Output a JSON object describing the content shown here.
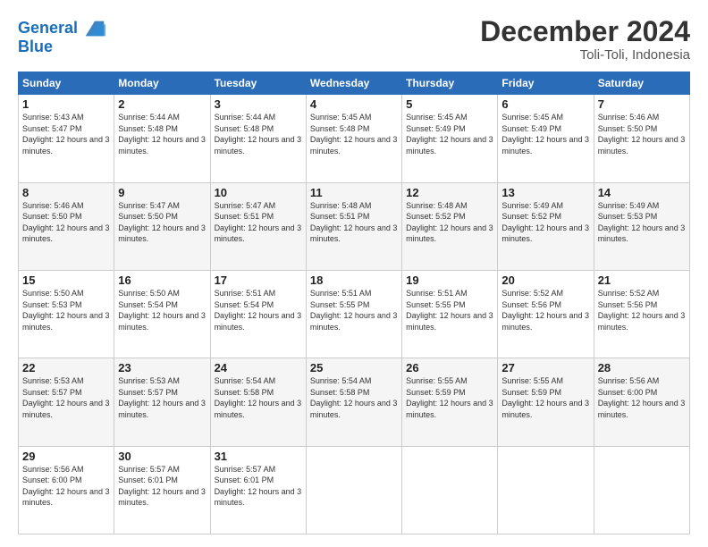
{
  "header": {
    "logo_line1": "General",
    "logo_line2": "Blue",
    "month_title": "December 2024",
    "location": "Toli-Toli, Indonesia"
  },
  "days_of_week": [
    "Sunday",
    "Monday",
    "Tuesday",
    "Wednesday",
    "Thursday",
    "Friday",
    "Saturday"
  ],
  "weeks": [
    [
      {
        "day": "1",
        "sunrise": "5:43 AM",
        "sunset": "5:47 PM",
        "daylight": "12 hours and 3 minutes."
      },
      {
        "day": "2",
        "sunrise": "5:44 AM",
        "sunset": "5:48 PM",
        "daylight": "12 hours and 3 minutes."
      },
      {
        "day": "3",
        "sunrise": "5:44 AM",
        "sunset": "5:48 PM",
        "daylight": "12 hours and 3 minutes."
      },
      {
        "day": "4",
        "sunrise": "5:45 AM",
        "sunset": "5:48 PM",
        "daylight": "12 hours and 3 minutes."
      },
      {
        "day": "5",
        "sunrise": "5:45 AM",
        "sunset": "5:49 PM",
        "daylight": "12 hours and 3 minutes."
      },
      {
        "day": "6",
        "sunrise": "5:45 AM",
        "sunset": "5:49 PM",
        "daylight": "12 hours and 3 minutes."
      },
      {
        "day": "7",
        "sunrise": "5:46 AM",
        "sunset": "5:50 PM",
        "daylight": "12 hours and 3 minutes."
      }
    ],
    [
      {
        "day": "8",
        "sunrise": "5:46 AM",
        "sunset": "5:50 PM",
        "daylight": "12 hours and 3 minutes."
      },
      {
        "day": "9",
        "sunrise": "5:47 AM",
        "sunset": "5:50 PM",
        "daylight": "12 hours and 3 minutes."
      },
      {
        "day": "10",
        "sunrise": "5:47 AM",
        "sunset": "5:51 PM",
        "daylight": "12 hours and 3 minutes."
      },
      {
        "day": "11",
        "sunrise": "5:48 AM",
        "sunset": "5:51 PM",
        "daylight": "12 hours and 3 minutes."
      },
      {
        "day": "12",
        "sunrise": "5:48 AM",
        "sunset": "5:52 PM",
        "daylight": "12 hours and 3 minutes."
      },
      {
        "day": "13",
        "sunrise": "5:49 AM",
        "sunset": "5:52 PM",
        "daylight": "12 hours and 3 minutes."
      },
      {
        "day": "14",
        "sunrise": "5:49 AM",
        "sunset": "5:53 PM",
        "daylight": "12 hours and 3 minutes."
      }
    ],
    [
      {
        "day": "15",
        "sunrise": "5:50 AM",
        "sunset": "5:53 PM",
        "daylight": "12 hours and 3 minutes."
      },
      {
        "day": "16",
        "sunrise": "5:50 AM",
        "sunset": "5:54 PM",
        "daylight": "12 hours and 3 minutes."
      },
      {
        "day": "17",
        "sunrise": "5:51 AM",
        "sunset": "5:54 PM",
        "daylight": "12 hours and 3 minutes."
      },
      {
        "day": "18",
        "sunrise": "5:51 AM",
        "sunset": "5:55 PM",
        "daylight": "12 hours and 3 minutes."
      },
      {
        "day": "19",
        "sunrise": "5:51 AM",
        "sunset": "5:55 PM",
        "daylight": "12 hours and 3 minutes."
      },
      {
        "day": "20",
        "sunrise": "5:52 AM",
        "sunset": "5:56 PM",
        "daylight": "12 hours and 3 minutes."
      },
      {
        "day": "21",
        "sunrise": "5:52 AM",
        "sunset": "5:56 PM",
        "daylight": "12 hours and 3 minutes."
      }
    ],
    [
      {
        "day": "22",
        "sunrise": "5:53 AM",
        "sunset": "5:57 PM",
        "daylight": "12 hours and 3 minutes."
      },
      {
        "day": "23",
        "sunrise": "5:53 AM",
        "sunset": "5:57 PM",
        "daylight": "12 hours and 3 minutes."
      },
      {
        "day": "24",
        "sunrise": "5:54 AM",
        "sunset": "5:58 PM",
        "daylight": "12 hours and 3 minutes."
      },
      {
        "day": "25",
        "sunrise": "5:54 AM",
        "sunset": "5:58 PM",
        "daylight": "12 hours and 3 minutes."
      },
      {
        "day": "26",
        "sunrise": "5:55 AM",
        "sunset": "5:59 PM",
        "daylight": "12 hours and 3 minutes."
      },
      {
        "day": "27",
        "sunrise": "5:55 AM",
        "sunset": "5:59 PM",
        "daylight": "12 hours and 3 minutes."
      },
      {
        "day": "28",
        "sunrise": "5:56 AM",
        "sunset": "6:00 PM",
        "daylight": "12 hours and 3 minutes."
      }
    ],
    [
      {
        "day": "29",
        "sunrise": "5:56 AM",
        "sunset": "6:00 PM",
        "daylight": "12 hours and 3 minutes."
      },
      {
        "day": "30",
        "sunrise": "5:57 AM",
        "sunset": "6:01 PM",
        "daylight": "12 hours and 3 minutes."
      },
      {
        "day": "31",
        "sunrise": "5:57 AM",
        "sunset": "6:01 PM",
        "daylight": "12 hours and 3 minutes."
      },
      null,
      null,
      null,
      null
    ]
  ]
}
